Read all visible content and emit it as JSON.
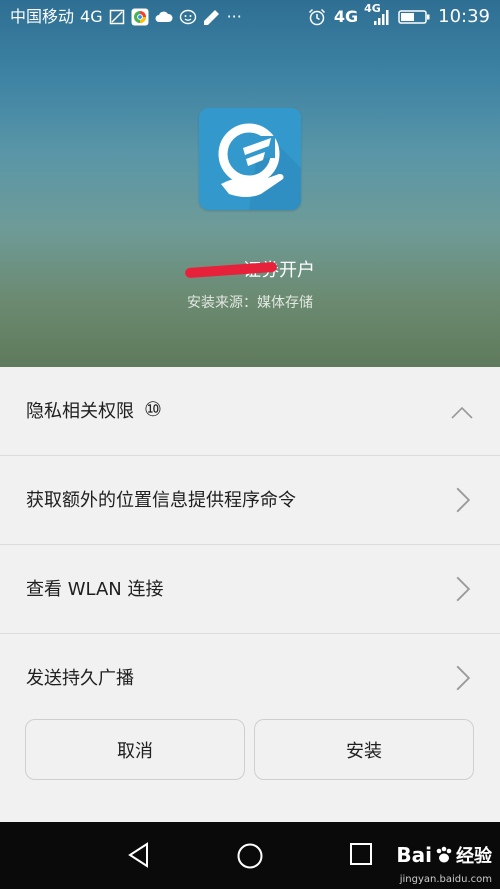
{
  "status_bar": {
    "carrier": "中国移动",
    "network": "4G",
    "network_right": "4G",
    "network_small": "4G",
    "time": "10:39",
    "overflow": "···"
  },
  "app": {
    "name_suffix": "证券开户",
    "install_source": "安装来源：媒体存储"
  },
  "permissions": {
    "header_label": "隐私相关权限",
    "count": "⑩",
    "items": [
      {
        "label": "获取额外的位置信息提供程序命令"
      },
      {
        "label": "查看 WLAN 连接"
      },
      {
        "label": "发送持久广播"
      }
    ]
  },
  "buttons": {
    "cancel": "取消",
    "install": "安装"
  },
  "watermark": {
    "brand": "Bai",
    "brand_suffix": "经验",
    "url": "jingyan.baidu.com"
  },
  "colors": {
    "accent": "#3399cc",
    "redaction": "#e8213a"
  }
}
